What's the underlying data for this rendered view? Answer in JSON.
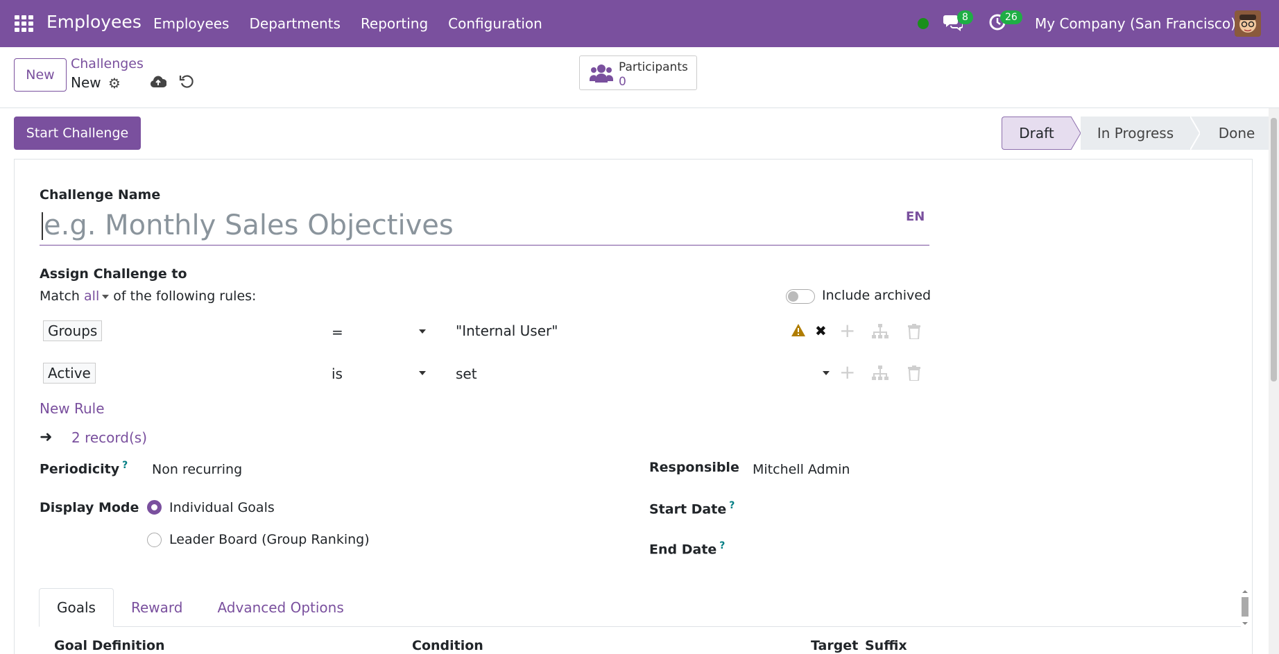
{
  "navbar": {
    "app_title": "Employees",
    "menu": [
      "Employees",
      "Departments",
      "Reporting",
      "Configuration"
    ],
    "chat_count": "8",
    "activity_count": "26",
    "company": "My Company (San Francisco)"
  },
  "control": {
    "new_label": "New",
    "breadcrumb_parent": "Challenges",
    "breadcrumb_current": "New",
    "participants_label": "Participants",
    "participants_count": "0"
  },
  "statusbar": {
    "start_label": "Start Challenge",
    "stages": [
      "Draft",
      "In Progress",
      "Done"
    ],
    "active_stage": "Draft"
  },
  "form": {
    "name_label": "Challenge Name",
    "name_placeholder": "e.g. Monthly Sales Objectives",
    "lang": "EN",
    "assign_label": "Assign Challenge to",
    "match_prefix": "Match",
    "match_value": "all",
    "match_suffix": "of the following rules:",
    "include_archived": "Include archived",
    "rules": [
      {
        "field": "Groups",
        "operator": "=",
        "value": "\"Internal User\""
      },
      {
        "field": "Active",
        "operator": "is",
        "value": "set"
      }
    ],
    "new_rule": "New Rule",
    "records": "2 record(s)",
    "periodicity_label": "Periodicity",
    "periodicity_value": "Non recurring",
    "responsible_label": "Responsible",
    "responsible_value": "Mitchell Admin",
    "display_mode_label": "Display Mode",
    "display_options": [
      "Individual Goals",
      "Leader Board (Group Ranking)"
    ],
    "start_date_label": "Start Date",
    "end_date_label": "End Date",
    "help_mark": "?"
  },
  "tabs": [
    "Goals",
    "Reward",
    "Advanced Options"
  ],
  "goals_table": {
    "headers": [
      "Goal Definition",
      "Condition",
      "Target",
      "Suffix"
    ]
  }
}
